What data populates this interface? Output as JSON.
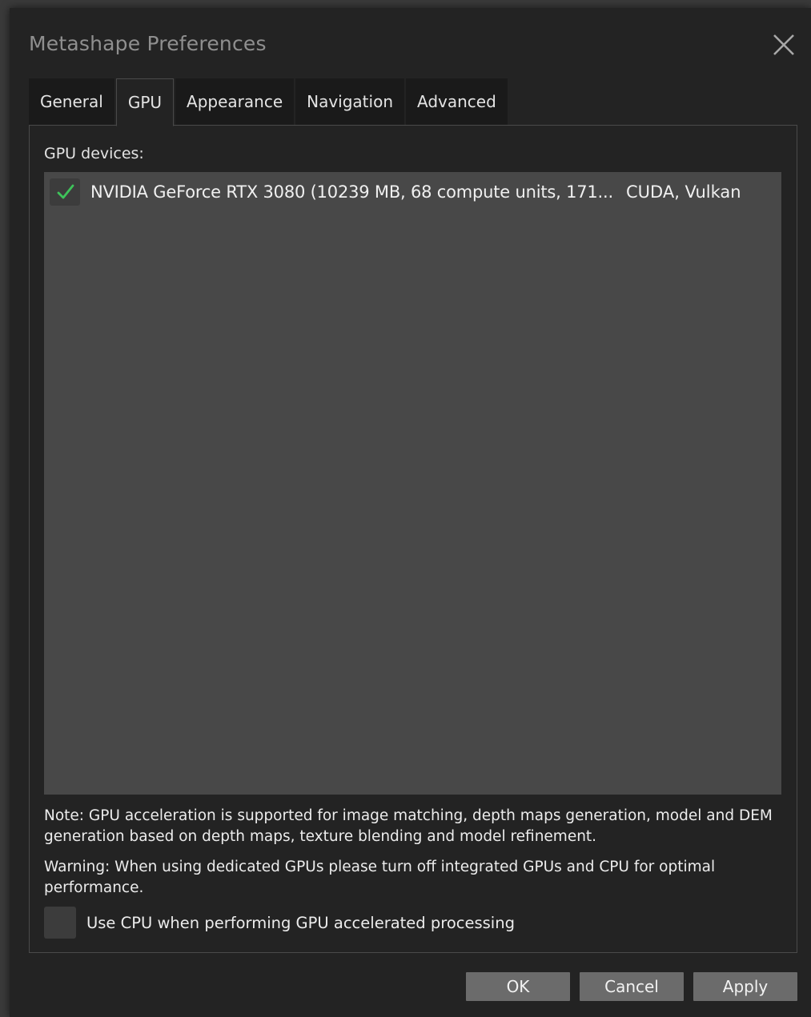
{
  "window": {
    "title": "Metashape Preferences"
  },
  "tabs": [
    {
      "label": "General",
      "active": false
    },
    {
      "label": "GPU",
      "active": true
    },
    {
      "label": "Appearance",
      "active": false
    },
    {
      "label": "Navigation",
      "active": false
    },
    {
      "label": "Advanced",
      "active": false
    }
  ],
  "gpu": {
    "devices_label": "GPU devices:",
    "devices": [
      {
        "checked": true,
        "name": "NVIDIA GeForce RTX 3080 (10239 MB, 68 compute units, 171...",
        "api": "CUDA, Vulkan"
      }
    ],
    "note": "Note: GPU acceleration is supported for image matching, depth maps generation, model and DEM generation based on depth maps, texture blending and model refinement.",
    "warning": "Warning: When using dedicated GPUs please turn off integrated GPUs and CPU for optimal performance.",
    "use_cpu": {
      "label": "Use CPU when performing GPU accelerated processing",
      "checked": false
    }
  },
  "buttons": {
    "ok": "OK",
    "cancel": "Cancel",
    "apply": "Apply"
  },
  "icons": {
    "close": "close-icon",
    "check": "checkmark-icon"
  },
  "colors": {
    "check_green": "#3ec35a",
    "dialog_bg": "#232323",
    "list_bg": "#484848",
    "button_bg": "#6b6b6b"
  }
}
